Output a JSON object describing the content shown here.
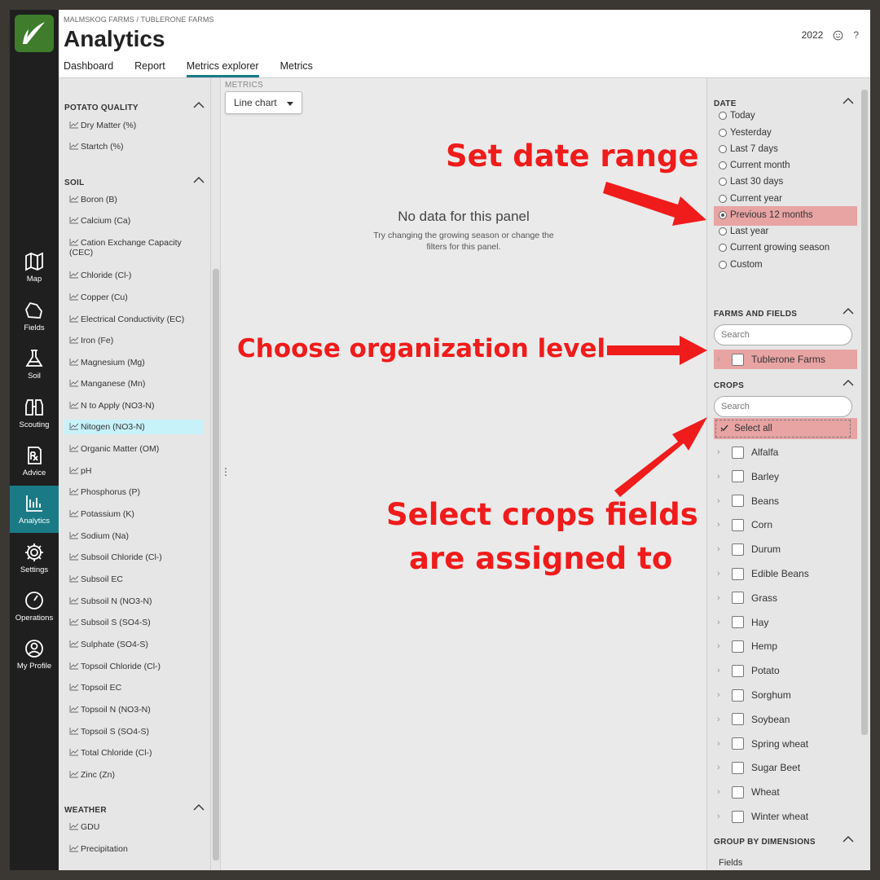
{
  "breadcrumb": "MALMSKOG FARMS / TUBLERONE FARMS",
  "title": "Analytics",
  "year": "2022",
  "tabs": [
    {
      "label": "Dashboard"
    },
    {
      "label": "Report"
    },
    {
      "label": "Metrics explorer",
      "active": true
    },
    {
      "label": "Metrics"
    }
  ],
  "nav": [
    {
      "label": "Map",
      "icon": "map-icon"
    },
    {
      "label": "Fields",
      "icon": "fields-icon"
    },
    {
      "label": "Soil",
      "icon": "flask-icon"
    },
    {
      "label": "Scouting",
      "icon": "binoculars-icon"
    },
    {
      "label": "Advice",
      "icon": "prescription-icon"
    },
    {
      "label": "Analytics",
      "icon": "analytics-icon",
      "active": true
    },
    {
      "label": "Settings",
      "icon": "gear-icon"
    },
    {
      "label": "Operations",
      "icon": "gauge-icon"
    },
    {
      "label": "My Profile",
      "icon": "user-circle-icon"
    }
  ],
  "metric_groups": [
    {
      "title": "POTATO QUALITY",
      "items": [
        "Dry Matter (%)",
        "Startch (%)"
      ]
    },
    {
      "title": "SOIL",
      "items": [
        "Boron (B)",
        "Calcium (Ca)",
        "Cation Exchange Capacity (CEC)",
        "Chloride (Cl-)",
        "Copper (Cu)",
        "Electrical Conductivity (EC)",
        "Iron (Fe)",
        "Magnesium (Mg)",
        "Manganese (Mn)",
        "N to Apply (NO3-N)",
        "Nitogen (NO3-N)",
        "Organic Matter (OM)",
        "pH",
        "Phosphorus (P)",
        "Potassium (K)",
        "Sodium (Na)",
        "Subsoil Chloride (Cl-)",
        "Subsoil EC",
        "Subsoil N (NO3-N)",
        "Subsoil S (SO4-S)",
        "Sulphate (SO4-S)",
        "Topsoil Chloride (Cl-)",
        "Topsoil EC",
        "Topsoil N (NO3-N)",
        "Topsoil S (SO4-S)",
        "Total Chloride (Cl-)",
        "Zinc (Zn)"
      ]
    },
    {
      "title": "WEATHER",
      "items": [
        "GDU",
        "Precipitation"
      ]
    }
  ],
  "selected_metric": "Nitogen (NO3-N)",
  "center": {
    "metrics_label": "METRICS",
    "chart_type": "Line chart",
    "no_data_title": "No data for this panel",
    "no_data_hint": "Try changing the growing season or change the filters for this panel."
  },
  "date": {
    "title": "DATE",
    "options": [
      "Today",
      "Yesterday",
      "Last 7 days",
      "Current month",
      "Last 30 days",
      "Current year",
      "Previous 12 months",
      "Last year",
      "Current growing season",
      "Custom"
    ],
    "selected": "Previous 12 months"
  },
  "farms": {
    "title": "FARMS AND FIELDS",
    "search_placeholder": "Search",
    "items": [
      "Tublerone Farms"
    ]
  },
  "crops": {
    "title": "CROPS",
    "search_placeholder": "Search",
    "select_all": "Select all",
    "items": [
      "Alfalfa",
      "Barley",
      "Beans",
      "Corn",
      "Durum",
      "Edible Beans",
      "Grass",
      "Hay",
      "Hemp",
      "Potato",
      "Sorghum",
      "Soybean",
      "Spring wheat",
      "Sugar Beet",
      "Wheat",
      "Winter wheat"
    ]
  },
  "group_by": {
    "title": "GROUP BY DIMENSIONS",
    "value": "Fields"
  },
  "annotations": {
    "date_range": "Set date range",
    "org_level": "Choose organization level",
    "crops_line1": "Select crops fields",
    "crops_line2": "are assigned to",
    "color": "#f01b1b"
  },
  "colors": {
    "accent": "#1a7b86",
    "highlight": "#e8a3a3",
    "selected_metric_bg": "#c8f2f9",
    "nav_bg": "#1f1f1f",
    "logo_green": "#3f7d2c"
  }
}
